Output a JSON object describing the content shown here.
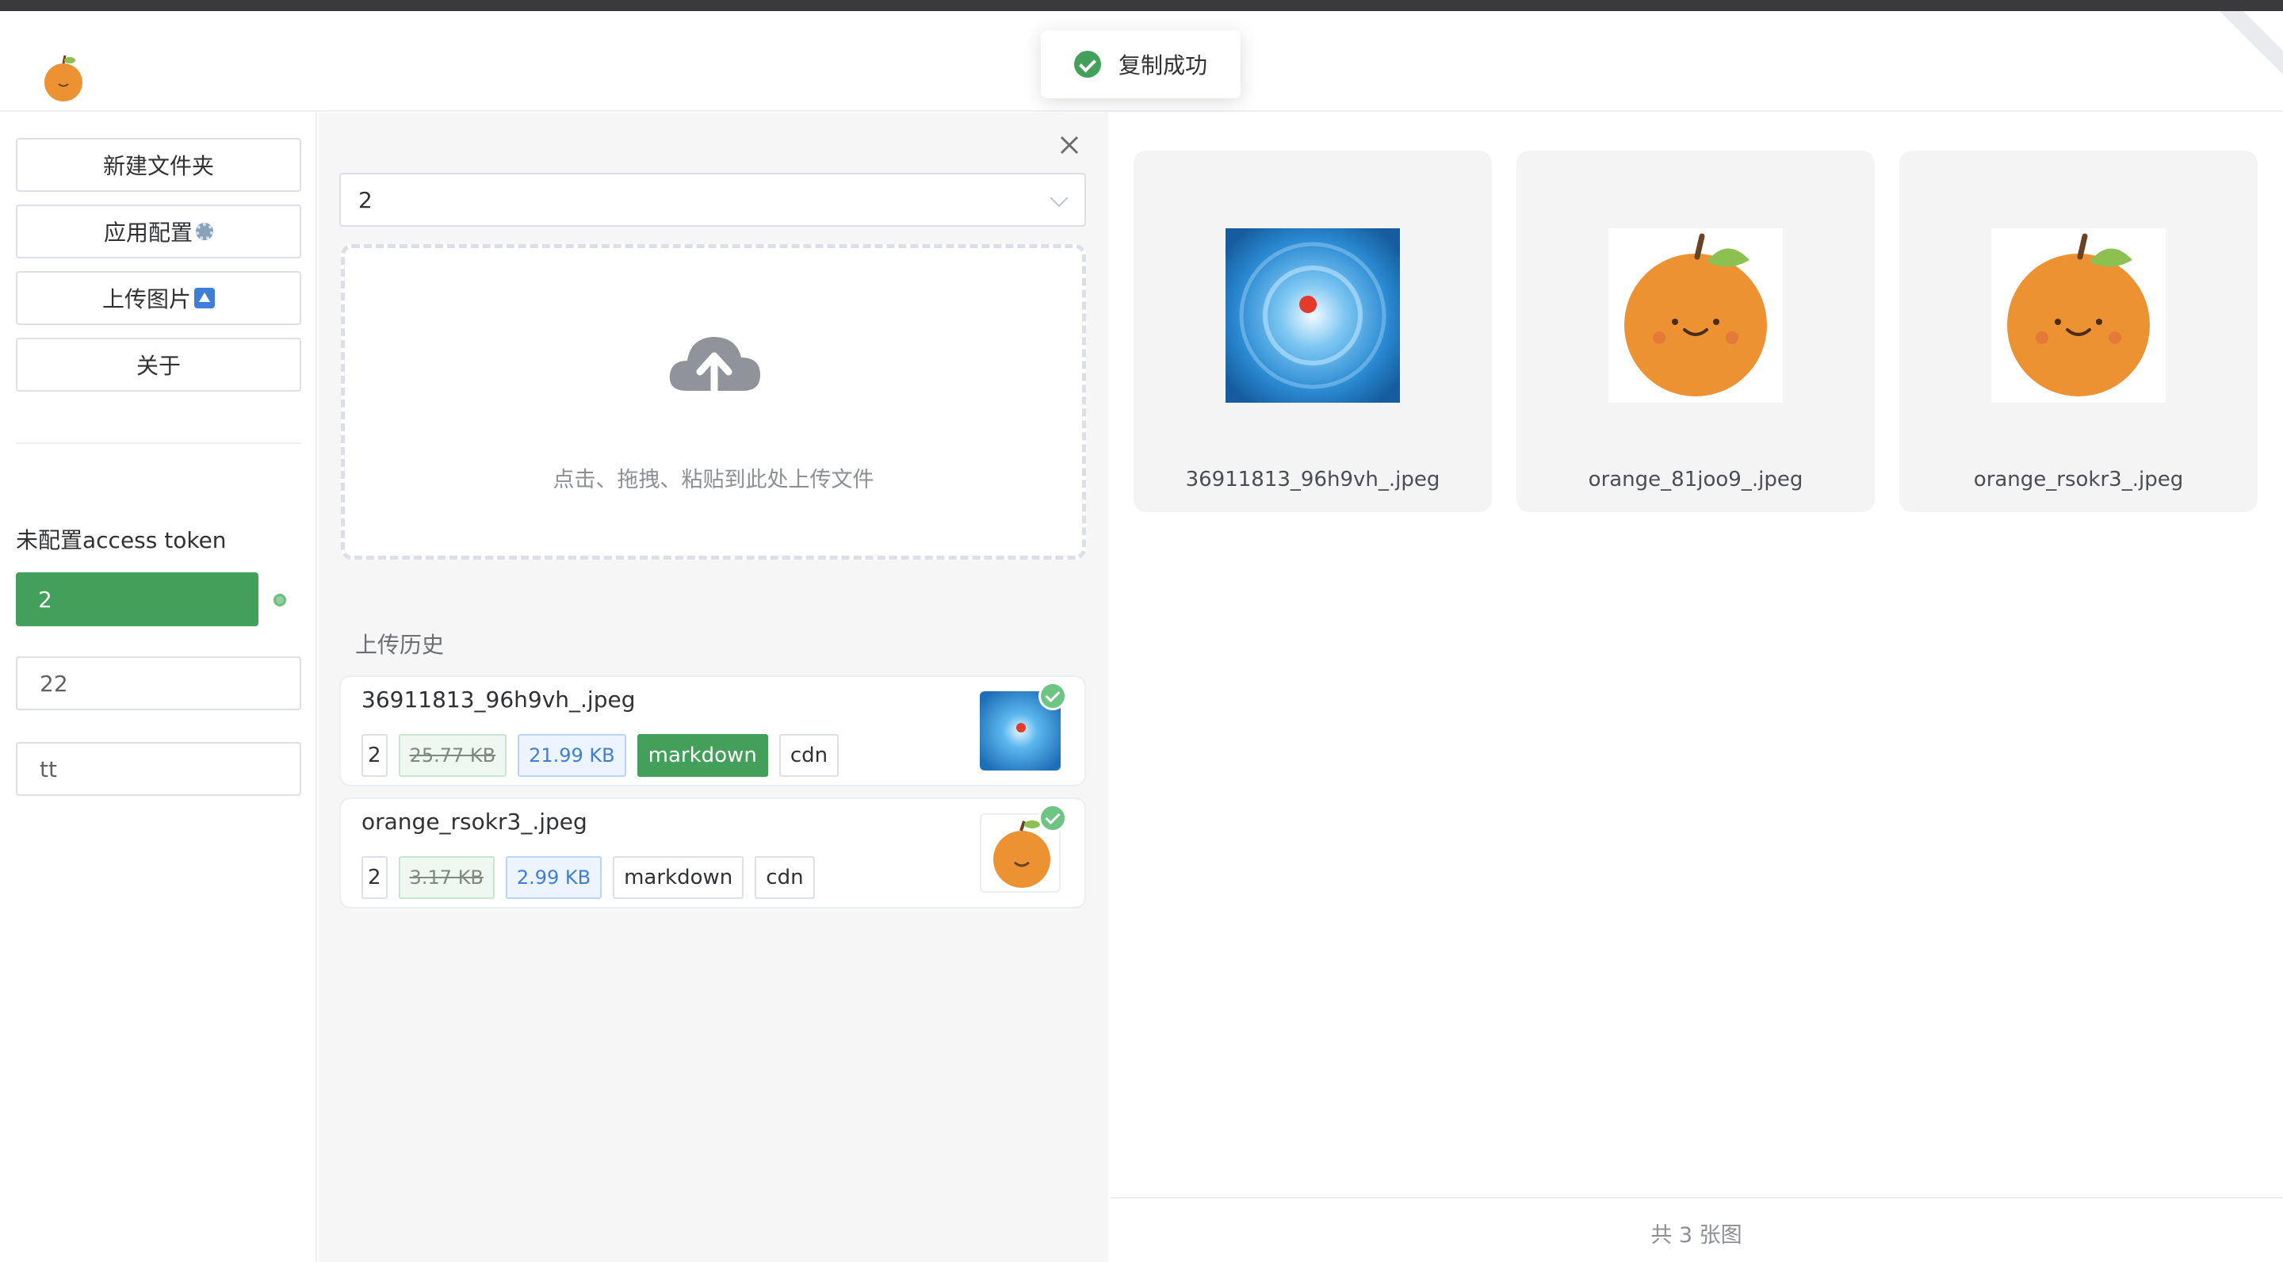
{
  "toast": {
    "message": "复制成功",
    "icon": "check-circle-icon"
  },
  "sidebar": {
    "buttons": [
      {
        "label": "新建文件夹"
      },
      {
        "label": "应用配置",
        "emoji": "gear-icon"
      },
      {
        "label": "上传图片",
        "emoji": "up-arrow-icon"
      },
      {
        "label": "关于"
      }
    ],
    "token_status": "未配置access token",
    "repos": [
      "2",
      "22",
      "tt"
    ],
    "active_repo": "2"
  },
  "upload": {
    "selected_dir": "2",
    "drop_hint": "点击、拖拽、粘贴到此处上传文件"
  },
  "history": {
    "title": "上传历史",
    "items": [
      {
        "name": "36911813_96h9vh_.jpeg",
        "repo": "2",
        "original_size": "25.77 KB",
        "compressed_size": "21.99 KB",
        "link1": "markdown",
        "link2": "cdn",
        "active_link": "markdown"
      },
      {
        "name": "orange_rsokr3_.jpeg",
        "repo": "2",
        "original_size": "3.17 KB",
        "compressed_size": "2.99 KB",
        "link1": "markdown",
        "link2": "cdn",
        "active_link": ""
      }
    ]
  },
  "gallery": {
    "images": [
      {
        "name": "36911813_96h9vh_.jpeg",
        "kind": "water-swirl"
      },
      {
        "name": "orange_81joo9_.jpeg",
        "kind": "orange"
      },
      {
        "name": "orange_rsokr3_.jpeg",
        "kind": "orange"
      }
    ],
    "count_text": "共 3 张图"
  },
  "colors": {
    "accent": "#43a05a",
    "size_blue": "#3e7ed8",
    "panel_bg": "#f6f6f7"
  }
}
